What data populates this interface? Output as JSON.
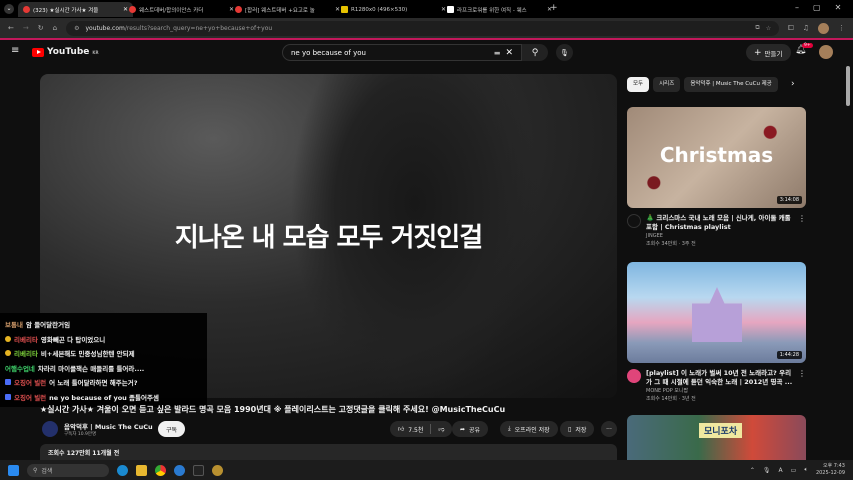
{
  "browser": {
    "tabs": [
      {
        "label": "(323) ★실시간 가사★ 겨울",
        "active": true
      },
      {
        "label": "웨스트데버/합의이안스 카더",
        "active": false
      },
      {
        "label": "[합러] 웨스트데버 +요고로 놀",
        "active": false
      },
      {
        "label": "R1280x0 (496×530)",
        "active": false
      },
      {
        "label": "라프크로워를 위한 여직 - 웨스",
        "active": false
      }
    ],
    "new_tab": "+",
    "url_host": "youtube.com",
    "url_path": "/results?search_query=ne+yo+because+of+you"
  },
  "youtube": {
    "logo": "YouTube",
    "logo_sup": "KR",
    "search_value": "ne yo because of you",
    "create_label": "만들기",
    "notif_count": "9+"
  },
  "video": {
    "lyric": "지나온 내 모습 모두 거짓인걸",
    "title": "★실시간 가사★ 겨울이 오면 듣고 싶은 발라드 명곡 모음 1990년대 ※ 플레이리스트는 고정댓글을 클릭해 주세요! @MusicTheCuCu",
    "channel": "음악덕후 | Music The CuCu",
    "subscribers": "구독자 10.9만명",
    "subscribe": "구독",
    "likes": "7.5천",
    "share": "공유",
    "offline": "오프라인 저장",
    "save": "저장",
    "more": "···",
    "views_date": "조회수 127만회  11개월 전"
  },
  "chat": [
    {
      "user": "보통내",
      "text": "암 들어달란거임",
      "color": "#d09a6a",
      "badge": ""
    },
    {
      "user": "리베리타",
      "text": "영화빼곤 다 탑이었으니",
      "color": "#e05050",
      "badge": "#e6b422"
    },
    {
      "user": "리베리타",
      "text": "비+세븐해도 민중성님한텐 안되제",
      "color": "#7ccf3a",
      "badge": "#e6b422"
    },
    {
      "user": "어햄수업네",
      "text": "차라리 마이클잭슨 매들리를 틀어라....",
      "color": "#3ed06a",
      "badge": ""
    },
    {
      "user": "오징어 빌런",
      "text": "어 노래 틀어달라하면 해주는거?",
      "color": "#e05050",
      "badge": "#4a6cf7"
    },
    {
      "user": "오징어 빌런",
      "text": "ne yo because of you 좀틀어주셈",
      "color": "#e05050",
      "badge": "#4a6cf7"
    }
  ],
  "sidebar": {
    "chips": [
      "모두",
      "시리즈",
      "음악덕후 | Music The CuCu 제공"
    ],
    "cards": [
      {
        "thumb_text": "Christmas",
        "duration": "3:14:08",
        "title": "🎄 크리스마스 국내 노래 모음 | 신나게, 아이돌 캐롤 포함 | Christmas playlist",
        "channel": "JINGEE",
        "stats": "조회수 34만회 · 3주 전"
      },
      {
        "thumb_text": "",
        "duration": "1:44:28",
        "title": "[playlist] 이 노래가 벌써 10년 전 노래라고? 우리가 그 때 시절에 듣던 익숙한 노래 | 2012년 띵곡 ...",
        "channel": "MONE POP 모니팝",
        "stats": "조회수 14만회 · 3년 전"
      },
      {
        "thumb_text": "모니포차",
        "duration": "",
        "title": "",
        "channel": "",
        "stats": ""
      }
    ]
  },
  "taskbar": {
    "search_placeholder": "검색",
    "time": "오후 7:43",
    "date": "2025-12-09"
  }
}
